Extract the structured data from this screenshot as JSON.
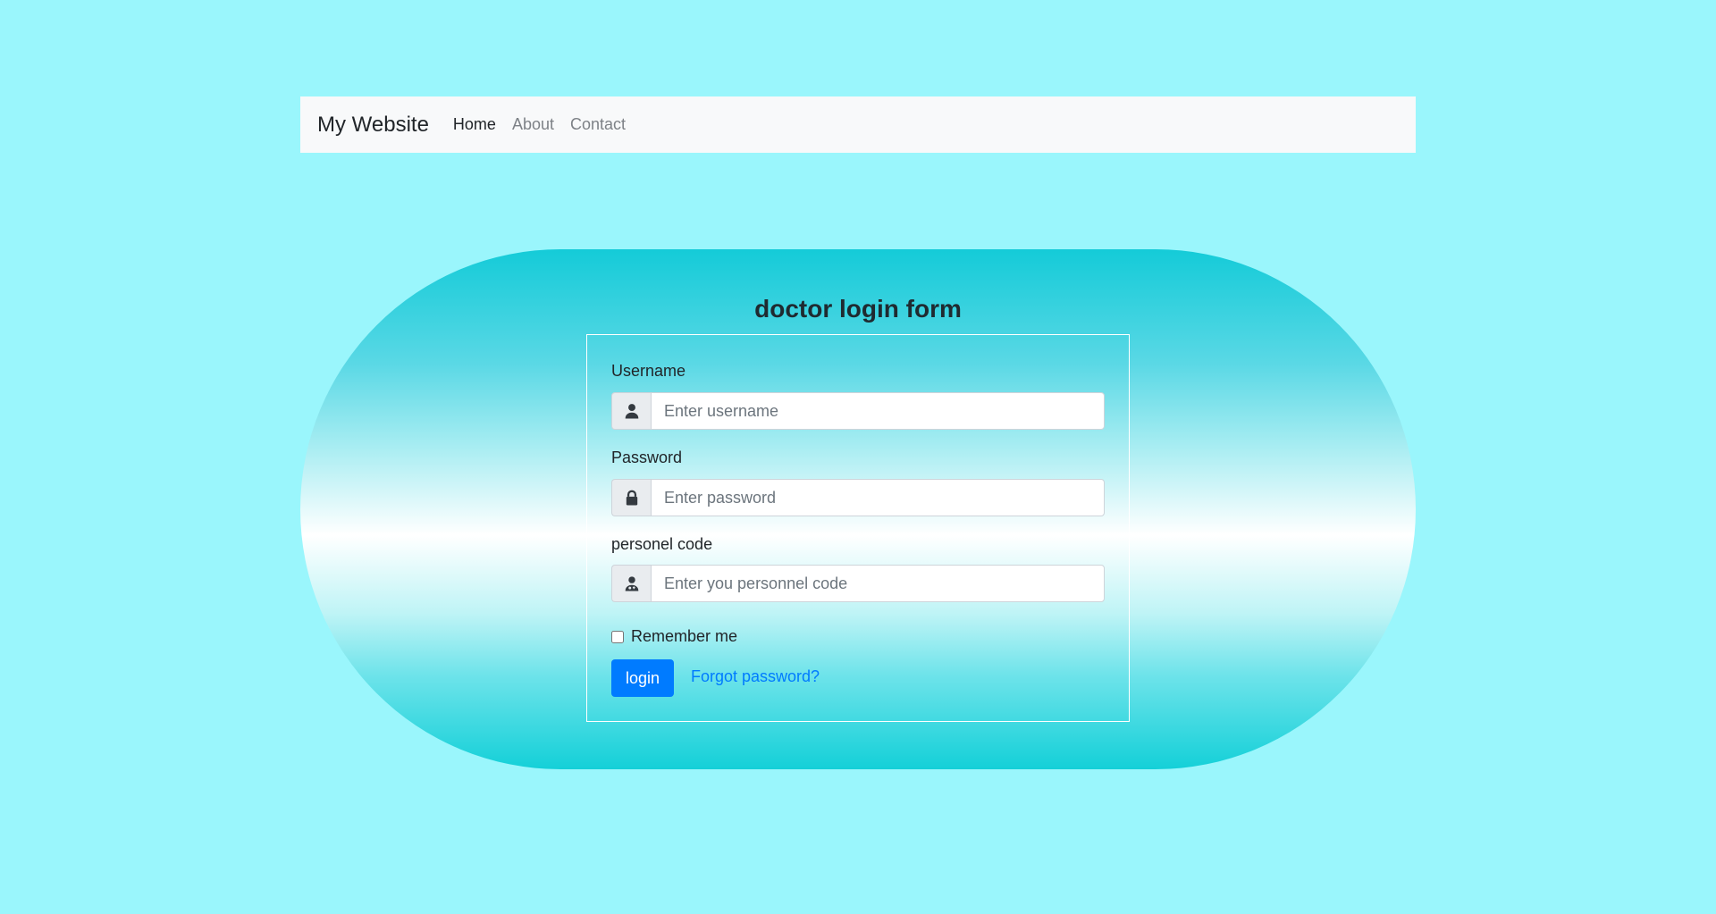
{
  "navbar": {
    "brand": "My Website",
    "links": [
      {
        "label": "Home",
        "active": true
      },
      {
        "label": "About",
        "active": false
      },
      {
        "label": "Contact",
        "active": false
      }
    ]
  },
  "form": {
    "title": "doctor login form",
    "username": {
      "label": "Username",
      "placeholder": "Enter username",
      "value": "",
      "icon": "user-icon"
    },
    "password": {
      "label": "Password",
      "placeholder": "Enter password",
      "value": "",
      "icon": "lock-icon"
    },
    "personnel_code": {
      "label": "personel code",
      "placeholder": "Enter you personnel code",
      "value": "",
      "icon": "user-doctor-icon"
    },
    "remember_label": "Remember me",
    "remember_checked": false,
    "login_label": "login",
    "forgot_label": "Forgot password?"
  },
  "colors": {
    "page_background": "#9af6fc",
    "navbar_background": "#f8f9fa",
    "primary": "#007bff",
    "gradient_edge": "#14cbd8",
    "gradient_center": "#ffffff"
  }
}
